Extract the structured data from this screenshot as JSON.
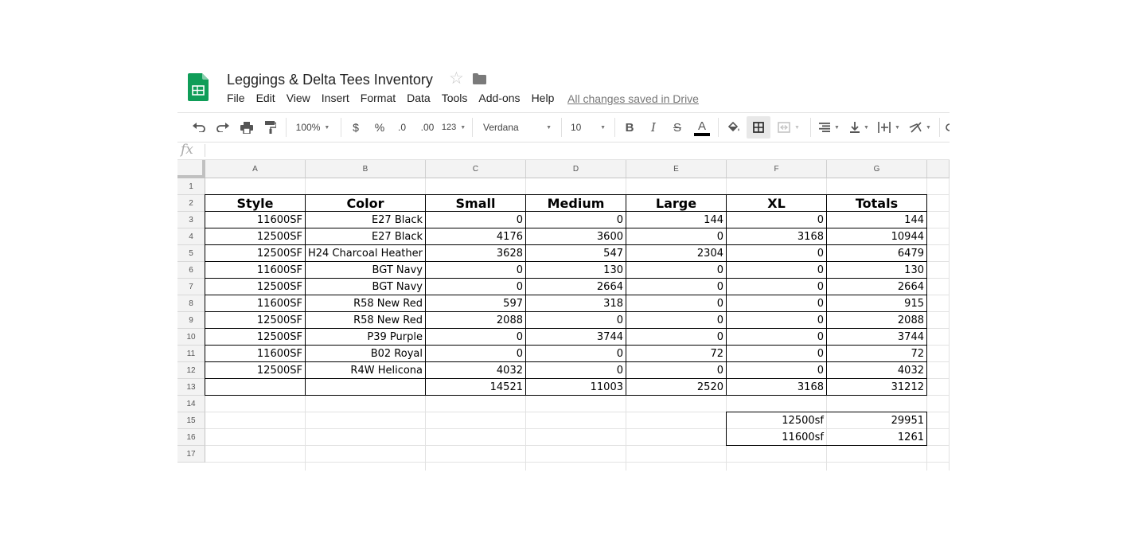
{
  "title": "Leggings & Delta Tees Inventory",
  "menus": [
    "File",
    "Edit",
    "View",
    "Insert",
    "Format",
    "Data",
    "Tools",
    "Add-ons",
    "Help"
  ],
  "save_status": "All changes saved in Drive",
  "toolbar": {
    "zoom": "100%",
    "currency": "$",
    "percent": "%",
    "decrease_decimal": ".0",
    "increase_decimal": ".00",
    "more_formats": "123",
    "font": "Verdana",
    "font_size": "10",
    "bold": "B",
    "italic": "I",
    "strike": "S",
    "text_color": "A"
  },
  "formula_bar": {
    "label": "fx",
    "value": ""
  },
  "columns": [
    "A",
    "B",
    "C",
    "D",
    "E",
    "F",
    "G"
  ],
  "rows": [
    "1",
    "2",
    "3",
    "4",
    "5",
    "6",
    "7",
    "8",
    "9",
    "10",
    "11",
    "12",
    "13",
    "14",
    "15",
    "16",
    "17"
  ],
  "header_row": [
    "Style",
    "Color",
    "Small",
    "Medium",
    "Large",
    "XL",
    "Totals"
  ],
  "data_rows": [
    [
      "11600SF",
      "E27 Black",
      "0",
      "0",
      "144",
      "0",
      "144"
    ],
    [
      "12500SF",
      "E27 Black",
      "4176",
      "3600",
      "0",
      "3168",
      "10944"
    ],
    [
      "12500SF",
      "H24 Charcoal Heather",
      "3628",
      "547",
      "2304",
      "0",
      "6479"
    ],
    [
      "11600SF",
      "BGT Navy",
      "0",
      "130",
      "0",
      "0",
      "130"
    ],
    [
      "12500SF",
      "BGT Navy",
      "0",
      "2664",
      "0",
      "0",
      "2664"
    ],
    [
      "11600SF",
      "R58 New Red",
      "597",
      "318",
      "0",
      "0",
      "915"
    ],
    [
      "12500SF",
      "R58 New Red",
      "2088",
      "0",
      "0",
      "0",
      "2088"
    ],
    [
      "12500SF",
      "P39 Purple",
      "0",
      "3744",
      "0",
      "0",
      "3744"
    ],
    [
      "11600SF",
      "B02 Royal",
      "0",
      "0",
      "72",
      "0",
      "72"
    ],
    [
      "12500SF",
      "R4W Helicona",
      "4032",
      "0",
      "0",
      "0",
      "4032"
    ]
  ],
  "totals_row": [
    "",
    "",
    "14521",
    "11003",
    "2520",
    "3168",
    "31212"
  ],
  "summary": [
    {
      "label": "12500sf",
      "value": "29951"
    },
    {
      "label": "11600sf",
      "value": "1261"
    }
  ],
  "colors": {
    "sheets_green": "#0f9d58",
    "grid_line": "#e2e2e2",
    "header_bg": "#f3f3f3"
  }
}
